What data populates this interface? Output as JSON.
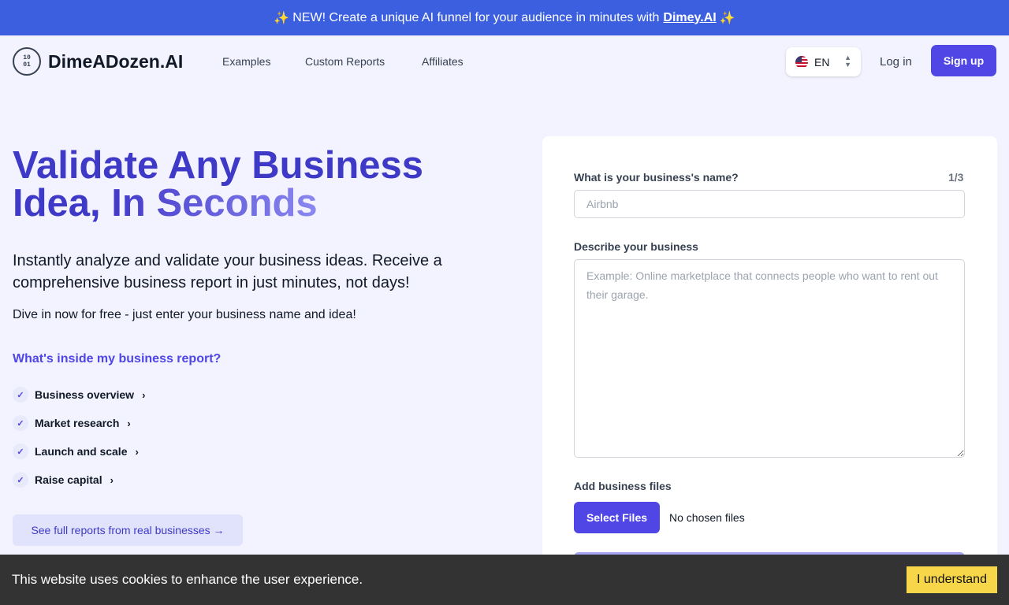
{
  "banner": {
    "text": "NEW! Create a unique AI funnel for your audience in minutes with",
    "link": "Dimey.AI",
    "spark_icon": "✨"
  },
  "nav": {
    "logo_mark": "10\n01",
    "logo_text": "DimeADozen.AI",
    "links": [
      "Examples",
      "Custom Reports",
      "Affiliates"
    ],
    "language": "EN",
    "login": "Log in",
    "signup": "Sign up"
  },
  "hero": {
    "title_part1": "Validate Any Business Idea,",
    "title_part2": "In Seconds",
    "lead": "Instantly analyze and validate your business ideas. Receive a comprehensive business report in just minutes, not days!",
    "sub": "Dive in now for free - just enter your business name and idea!",
    "inside_title": "What's inside my business report?",
    "items": [
      "Business overview",
      "Market research",
      "Launch and scale",
      "Raise capital"
    ],
    "reports_button": "See full reports from real businesses →"
  },
  "form": {
    "name_label": "What is your business's name?",
    "step": "1/3",
    "name_placeholder": "Airbnb",
    "desc_label": "Describe your business",
    "desc_placeholder": "Example: Online marketplace that connects people who want to rent out their garage.",
    "files_label": "Add business files",
    "files_button": "Select Files",
    "no_files": "No chosen files"
  },
  "cookie": {
    "text": "This website uses cookies to enhance the user experience.",
    "button": "I understand"
  },
  "colors": {
    "banner": "#3b5fdf",
    "accent": "#4f46e5",
    "cookie_bar": "#333333",
    "cookie_button": "#f7d64a"
  }
}
